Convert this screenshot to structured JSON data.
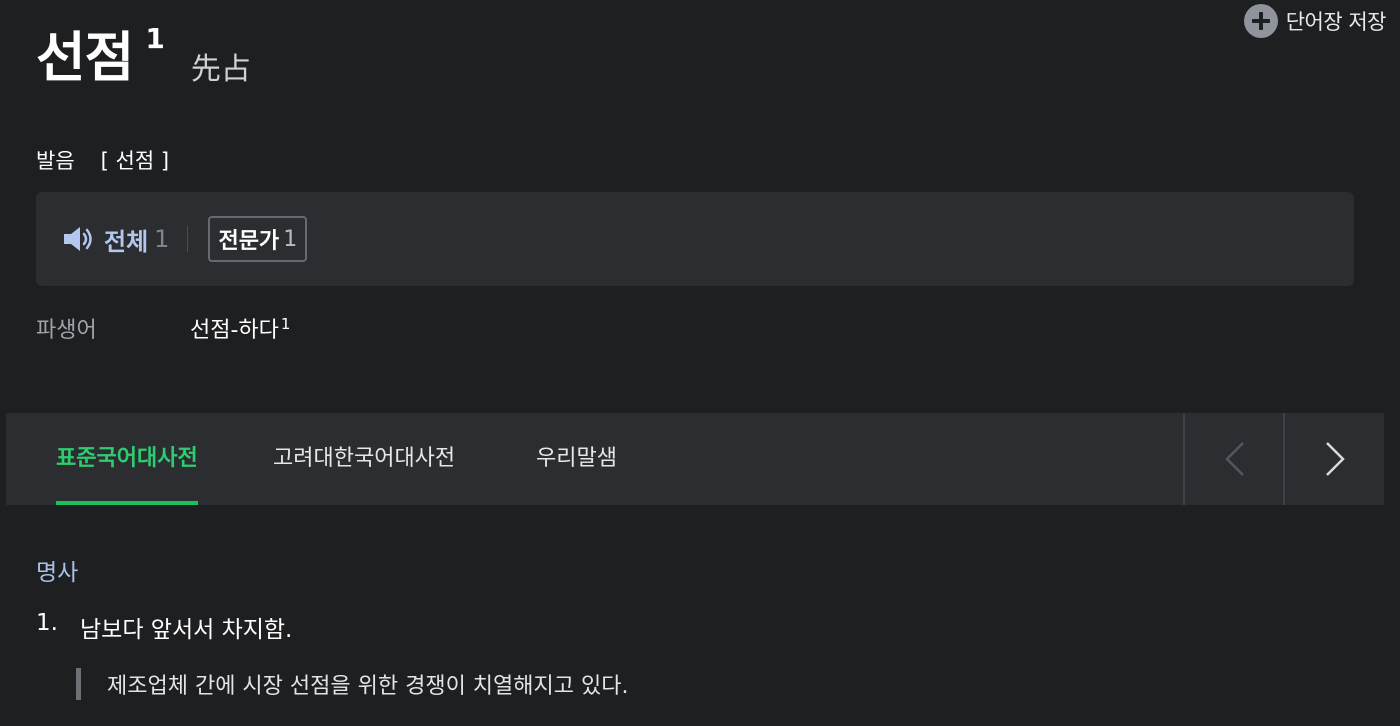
{
  "save": {
    "label": "단어장 저장"
  },
  "entry": {
    "headword": "선점",
    "homonym_no": "1",
    "hanja": "先占"
  },
  "pronunciation": {
    "label": "발음",
    "value": "[ 선점 ]"
  },
  "audio": {
    "all_label": "전체",
    "all_count": "1",
    "expert_label": "전문가",
    "expert_count": "1"
  },
  "derivative": {
    "label": "파생어",
    "word": "선점-하다",
    "sup": "1"
  },
  "tabs": [
    {
      "label": "표준국어대사전",
      "active": true
    },
    {
      "label": "고려대한국어대사전",
      "active": false
    },
    {
      "label": "우리말샘",
      "active": false
    }
  ],
  "nav": {
    "prev": "chevron-left-icon",
    "next": "chevron-right-icon"
  },
  "meaning": {
    "pos": "명사",
    "number": "1.",
    "definition": "남보다 앞서서 차지함.",
    "example": "제조업체 간에 시장 선점을 위한 경쟁이 치열해지고 있다."
  },
  "colors": {
    "background": "#1e1f21",
    "panel": "#2b2d30",
    "active_tab": "#19c25c",
    "audio_link": "#b4c7ee",
    "pos": "#a9c0e8"
  }
}
